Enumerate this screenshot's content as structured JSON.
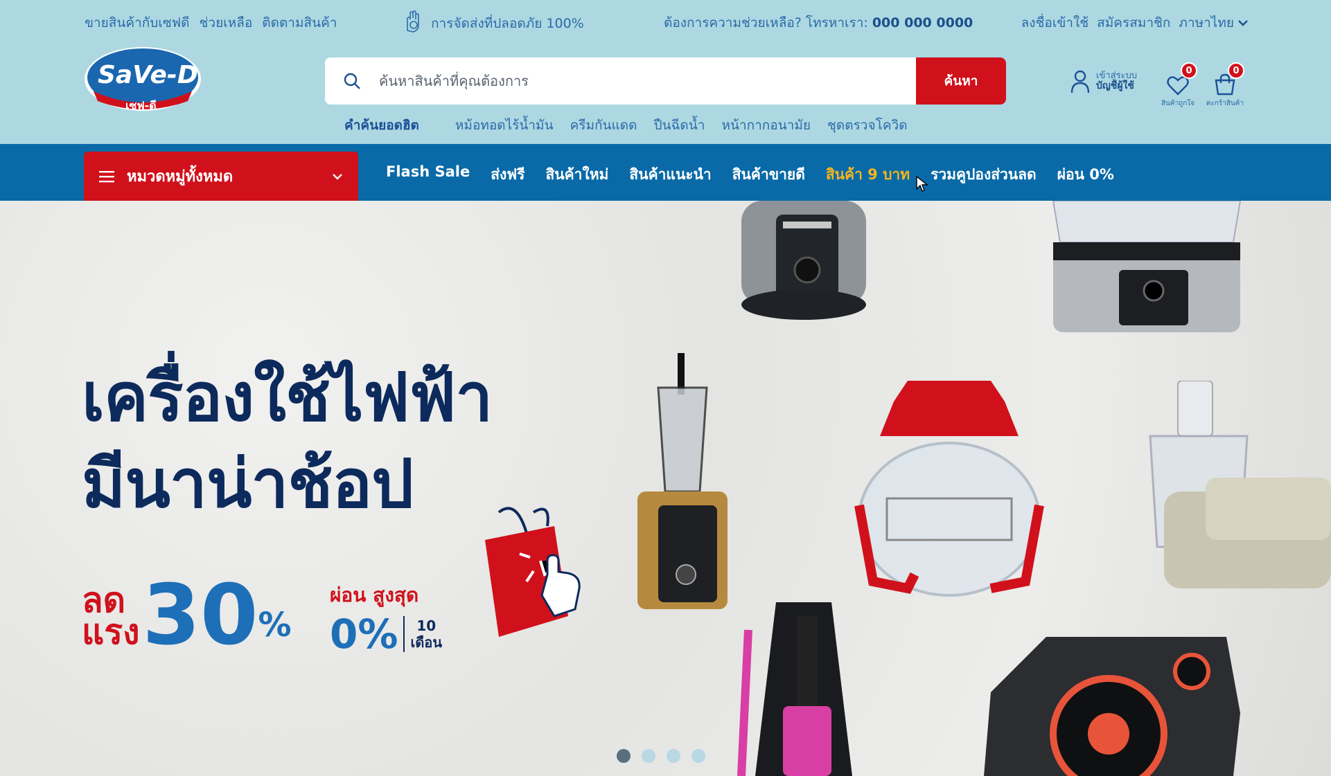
{
  "topbar": {
    "links_left": [
      "ขายสินค้ากับเซฟดี",
      "ช่วยเหลือ",
      "ติดตามสินค้า"
    ],
    "safe_delivery": "การจัดส่งที่ปลอดภัย 100%",
    "help_text": "ต้องการความช่วยเหลือ? โทรหาเรา:",
    "help_phone": "000 000 0000",
    "login": "ลงชื่อเข้าใช้",
    "register": "สมัครสมาชิก",
    "language": "ภาษาไทย"
  },
  "header": {
    "logo_text": "SaVe-D",
    "logo_sub": "เซฟ-ดี",
    "search_placeholder": "ค้นหาสินค้าที่คุณต้องการ",
    "search_button": "ค้นหา",
    "hot_label": "คำค้นยอดฮิต",
    "hot_keywords": [
      "หม้อทอดไร้น้ำมัน",
      "ครีมกันแดด",
      "ปืนฉีดน้ำ",
      "หน้ากากอนามัย",
      "ชุดตรวจโควิด"
    ],
    "account_line1": "เข้าสู่ระบบ",
    "account_line2": "บัญชีผู้ใช้",
    "wishlist_label": "สินค้าถูกใจ",
    "wishlist_count": "0",
    "cart_label": "ตะกร้าสินค้า",
    "cart_count": "0"
  },
  "nav": {
    "category_label": "หมวดหมู่ทั้งหมด",
    "links": [
      "Flash Sale",
      "ส่งฟรี",
      "สินค้าใหม่",
      "สินค้าแนะนำ",
      "สินค้าขายดี",
      "สินค้า 9 บาท",
      "รวมคูปองส่วนลด",
      "ผ่อน 0%"
    ]
  },
  "banner": {
    "headline_line1": "เครื่องใช้ไฟฟ้า",
    "headline_line2": "มีนาน่าช้อป",
    "discount_word1": "ลด",
    "discount_word2": "แรง",
    "discount_value": "30",
    "discount_unit": "%",
    "installment_title": "ผ่อน สูงสุด",
    "installment_rate": "0%",
    "installment_months": "10",
    "installment_unit": "เดือน",
    "slides": 4,
    "active_slide": 1
  },
  "colors": {
    "topbar_bg": "#ADD8E2",
    "nav_bg": "#0A6AA8",
    "accent_red": "#D0111C",
    "highlight_yellow": "#F5B51C",
    "headline_navy": "#0D2A5C"
  }
}
